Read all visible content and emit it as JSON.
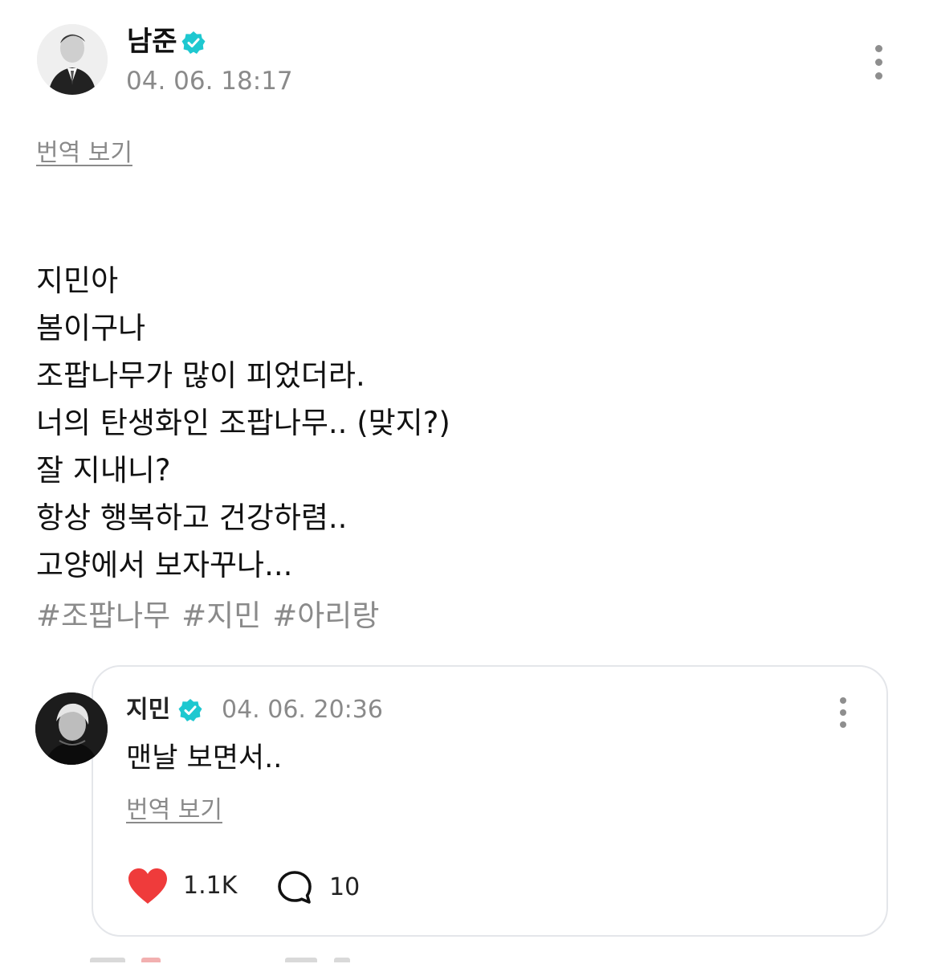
{
  "post": {
    "author": "남준",
    "timestamp": "04. 06. 18:17",
    "translate_label": "번역 보기",
    "lines": [
      "지민아",
      "봄이구나",
      "조팝나무가 많이 피었더라.",
      "너의 탄생화인 조팝나무.. (맞지?)",
      "잘 지내니?",
      "항상 행복하고 건강하렴..",
      "고양에서 보자꾸나..."
    ],
    "hashtags": [
      "#조팝나무",
      "#지민",
      "#아리랑"
    ]
  },
  "reply": {
    "author": "지민",
    "timestamp": "04. 06. 20:36",
    "text": "맨날 보면서..",
    "translate_label": "번역 보기",
    "likes": "1.1K",
    "comments": "10"
  },
  "icons": {
    "verified": "verified-badge-icon",
    "more": "more-vertical-icon",
    "like": "heart-icon",
    "comment": "speech-bubble-icon"
  },
  "colors": {
    "verified": "#1ec8d0",
    "like": "#ef3b3b",
    "muted_text": "#8a8a8a",
    "card_border": "#e4e6ea"
  }
}
